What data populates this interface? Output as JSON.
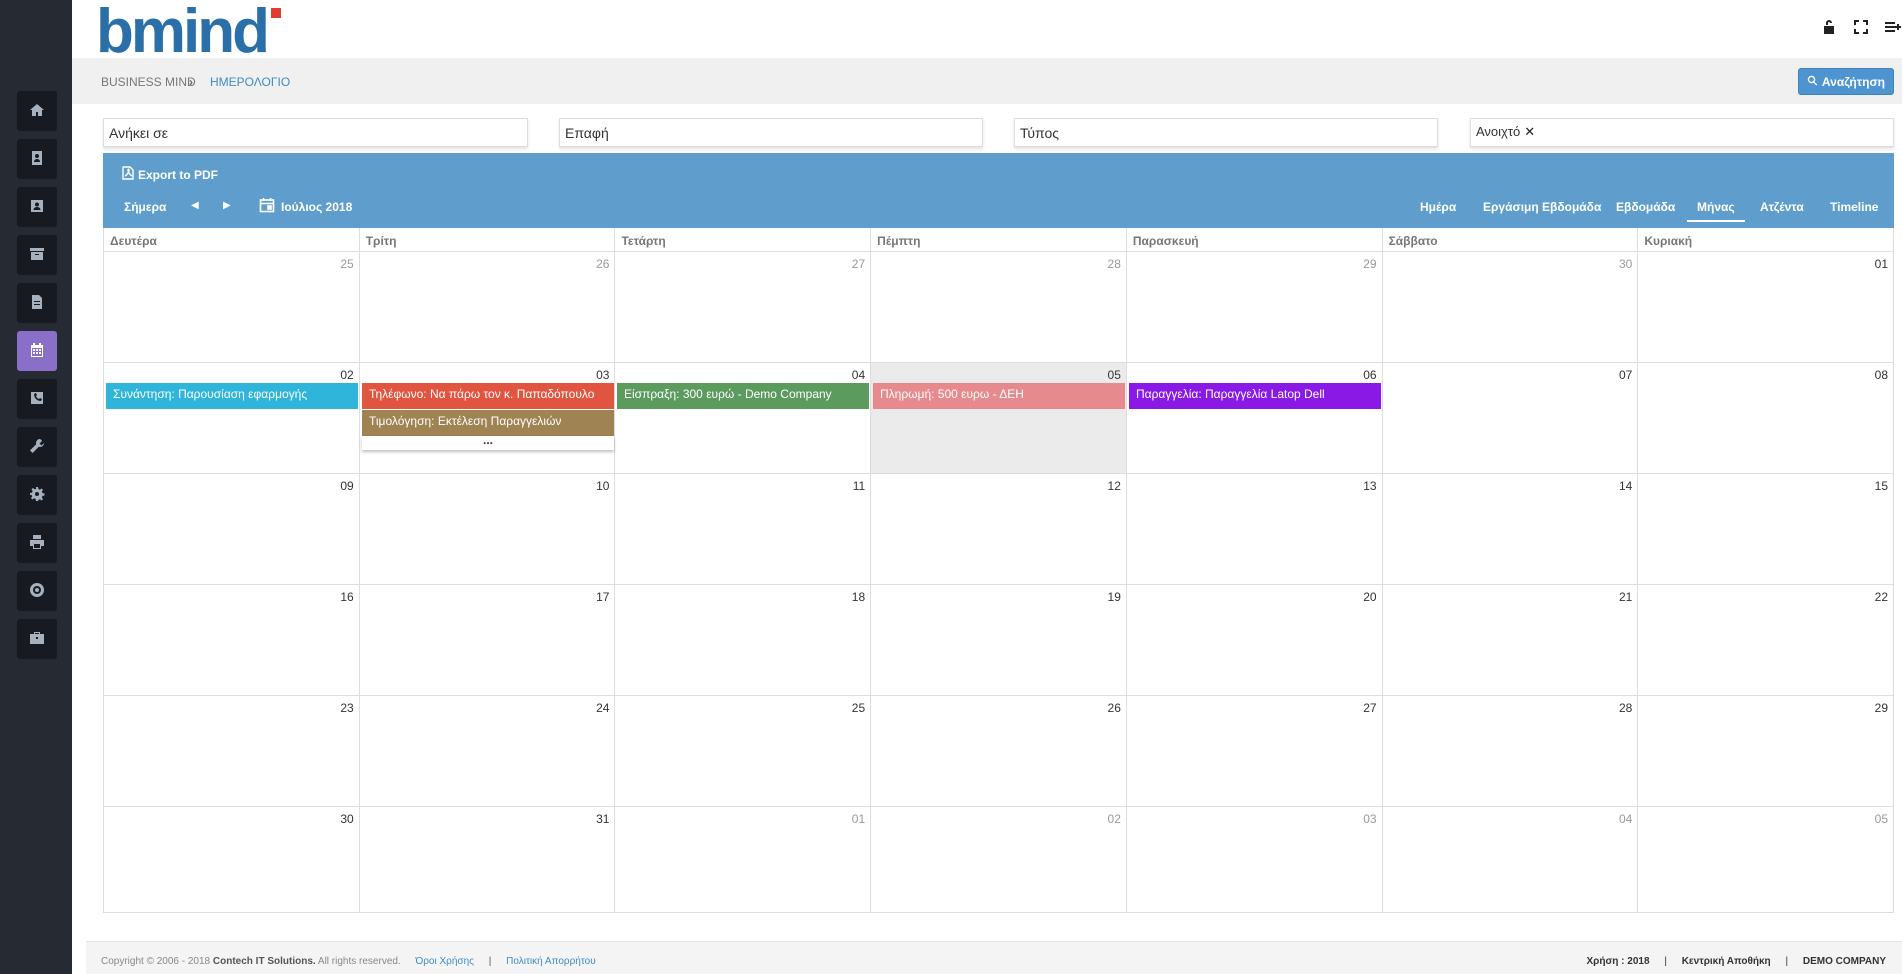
{
  "app": {
    "logo_text": "bmind",
    "brand_blue": "#2b6fa8",
    "brand_red": "#e03c31"
  },
  "sidebar": {
    "items": [
      {
        "name": "home-icon"
      },
      {
        "name": "address-book-icon"
      },
      {
        "name": "contact-card-icon"
      },
      {
        "name": "archive-icon"
      },
      {
        "name": "document-icon"
      },
      {
        "name": "calendar-icon",
        "active": true
      },
      {
        "name": "phone-icon"
      },
      {
        "name": "wrench-icon"
      },
      {
        "name": "gear-icon"
      },
      {
        "name": "printer-icon"
      },
      {
        "name": "support-icon"
      },
      {
        "name": "briefcase-icon"
      }
    ]
  },
  "header": {
    "icons": [
      "unlock-icon",
      "fullscreen-icon",
      "menu-add-icon"
    ]
  },
  "breadcrumb": {
    "root": "BUSINESS MIND",
    "separator": "›",
    "current": "ΗΜΕΡΟΛΟΓΙΟ"
  },
  "search_button": {
    "label": "Αναζήτηση"
  },
  "filters": {
    "owned_by": "Ανήκει σε",
    "contact": "Επαφή",
    "type": "Τύπος",
    "status": "Ανοιχτό",
    "status_clear": "✕"
  },
  "toolbar": {
    "export_label": "Export to PDF",
    "today_label": "Σήμερα",
    "prev": "◀",
    "next": "▶",
    "month_label": "Ιούλιος 2018",
    "views": {
      "day": "Ημέρα",
      "workweek": "Εργάσιμη Εβδομάδα",
      "week": "Εβδομάδα",
      "month": "Μήνας",
      "agenda": "Ατζέντα",
      "timeline": "Timeline"
    }
  },
  "calendar": {
    "days_of_week": [
      "Δευτέρα",
      "Τρίτη",
      "Τετάρτη",
      "Πέμπτη",
      "Παρασκευή",
      "Σάββατο",
      "Κυριακή"
    ],
    "weeks": [
      [
        "25",
        "26",
        "27",
        "28",
        "29",
        "30",
        "01"
      ],
      [
        "02",
        "03",
        "04",
        "05",
        "06",
        "07",
        "08"
      ],
      [
        "09",
        "10",
        "11",
        "12",
        "13",
        "14",
        "15"
      ],
      [
        "16",
        "17",
        "18",
        "19",
        "20",
        "21",
        "22"
      ],
      [
        "23",
        "24",
        "25",
        "26",
        "27",
        "28",
        "29"
      ],
      [
        "30",
        "31",
        "01",
        "02",
        "03",
        "04",
        "05"
      ]
    ],
    "events": {
      "meeting": "Συνάντηση: Παρουσίαση εφαρμογής",
      "phone": "Τηλέφωνο: Να πάρω τον κ. Παπαδόπουλο",
      "invoice": "Τιμολόγηση: Εκτέλεση Παραγγελιών",
      "receipt": "Είσπραξη: 300 ευρώ - Demo Company",
      "payment": "Πληρωμή: 500 ευρω - ΔΕΗ",
      "order": "Παραγγελία: Παραγγελία Latop Dell",
      "more": "..."
    },
    "event_colors": {
      "meeting": "#2fb5d9",
      "phone": "#e1543f",
      "invoice": "#a08352",
      "receipt": "#5b9b5e",
      "payment": "#e68a8e",
      "order": "#8a19e6"
    }
  },
  "footer": {
    "copyright_prefix": "Copyright © 2006 - 2018",
    "company": "Contech IT Solutions.",
    "rights": "All rights reserved.",
    "terms": "Όροι Χρήσης",
    "privacy": "Πολιτική Απορρήτου",
    "usage_year": "Χρήση : 2018",
    "warehouse": "Κεντρική Αποθήκη",
    "company_name": "DEMO COMPANY",
    "separator": "|"
  }
}
